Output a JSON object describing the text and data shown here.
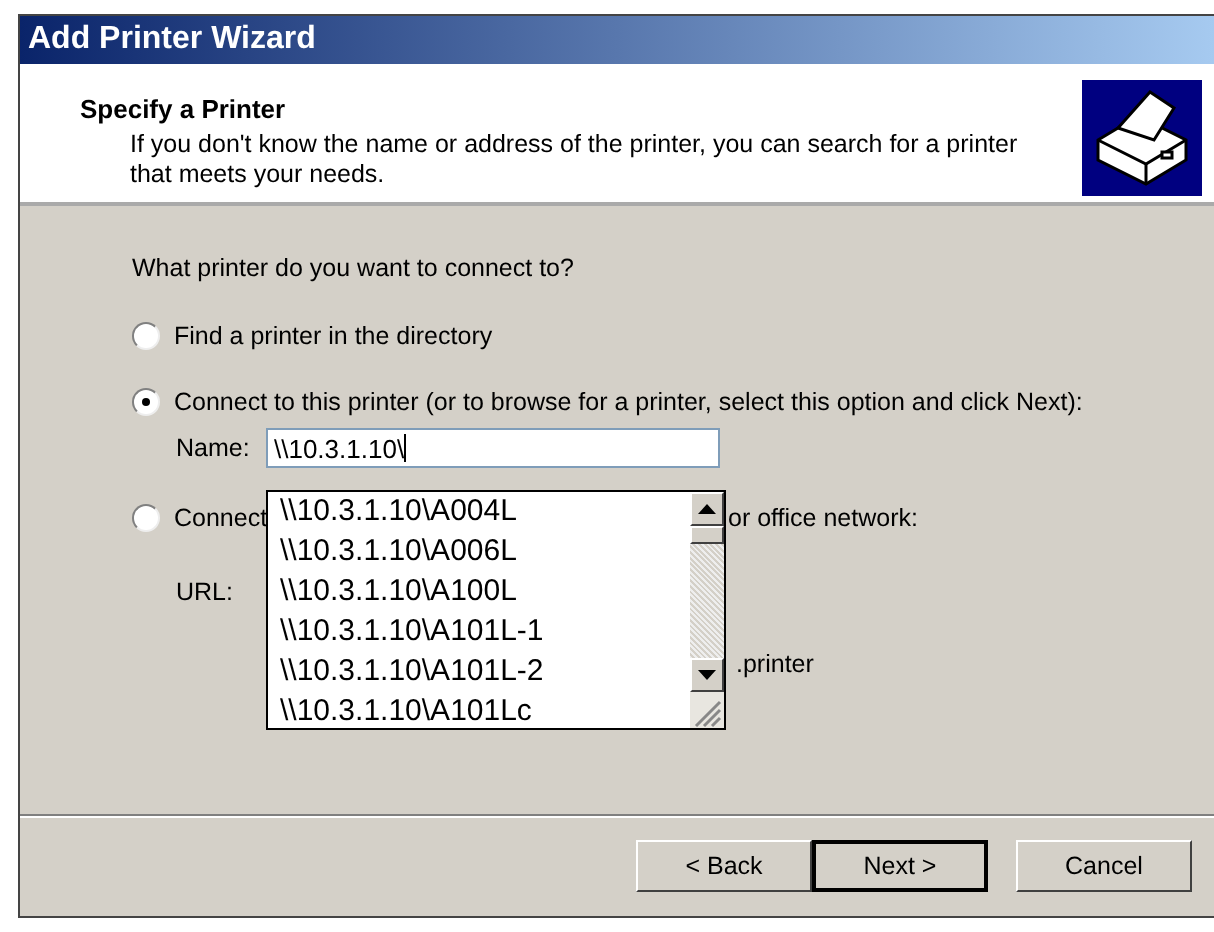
{
  "window": {
    "title": "Add Printer Wizard"
  },
  "header": {
    "title": "Specify a Printer",
    "description": "If you don't know the name or address of the printer, you can search for a printer that meets your needs."
  },
  "question": "What printer do you want to connect to?",
  "options": [
    {
      "label": "Find a printer in the directory",
      "selected": false
    },
    {
      "label": "Connect to this printer (or to browse for a printer, select this option and click Next):",
      "selected": true
    },
    {
      "label": "Connect",
      "label_tail": "or office network:",
      "selected": false
    }
  ],
  "name_field": {
    "label": "Name:",
    "value": "\\\\10.3.1.10\\"
  },
  "url_field": {
    "label": "URL:",
    "hint_tail": ".printer"
  },
  "suggestions": [
    {
      "text": "\\\\10.3.1.10\\A004L"
    },
    {
      "text": "\\\\10.3.1.10\\A006L"
    },
    {
      "text": "\\\\10.3.1.10\\A100L"
    },
    {
      "text": "\\\\10.3.1.10\\A101L-1"
    },
    {
      "text": "\\\\10.3.1.10\\A101L-2"
    },
    {
      "text": "\\\\10.3.1.10\\A101Lc"
    }
  ],
  "buttons": [
    {
      "label": "< Back",
      "default": false
    },
    {
      "label": "Next >",
      "default": true
    },
    {
      "label": "Cancel",
      "default": false
    }
  ]
}
